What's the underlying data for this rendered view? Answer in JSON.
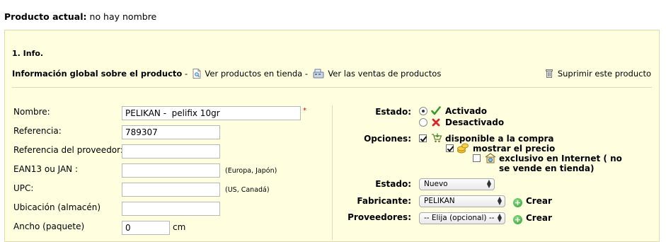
{
  "header": {
    "label": "Producto actual:",
    "value": "no hay nombre"
  },
  "section": {
    "title": "1. Info."
  },
  "global": {
    "label": "Información global sobre el producto",
    "dash": "-",
    "view_in_store": "Ver productos en tienda",
    "view_sales": "Ver las ventas de productos",
    "delete": "Suprimir este producto"
  },
  "fields": {
    "name": {
      "label": "Nombre:",
      "value": "PELIKAN -  pelifix 10gr",
      "required_mark": "*"
    },
    "reference": {
      "label": "Referencia:",
      "value": "789307"
    },
    "supplier_reference": {
      "label": "Referencia del proveedor:",
      "value": ""
    },
    "ean13": {
      "label": "EAN13 ou JAN :",
      "value": "",
      "hint": "(Europa, Japón)"
    },
    "upc": {
      "label": "UPC:",
      "value": "",
      "hint": "(US, Canadá)"
    },
    "location": {
      "label": "Ubicación (almacén)",
      "value": ""
    },
    "width": {
      "label": "Ancho (paquete)",
      "value": "0",
      "unit": "cm"
    }
  },
  "status": {
    "label": "Estado:",
    "activated": "Activado",
    "deactivated": "Desactivado",
    "selected": "Activado"
  },
  "options": {
    "label": "Opciones:",
    "available_for_order": "disponible a la compra",
    "show_price": "mostrar el precio",
    "online_only_1": "exclusivo en Internet ( no",
    "online_only_2": "se vende en tienda)",
    "available_for_order_checked": true,
    "show_price_checked": true,
    "online_only_checked": false
  },
  "condition": {
    "label": "Estado:",
    "value": "Nuevo"
  },
  "manufacturer": {
    "label": "Fabricante:",
    "value": "PELIKAN",
    "create": "Crear"
  },
  "suppliers": {
    "label": "Proveedores:",
    "value": "-- Elija (opcional) --",
    "create": "Crear"
  },
  "colors": {
    "panel_bg": "#ffffe0",
    "required": "#cc0000",
    "check_green": "#3a9a2a",
    "cross_red": "#d8262b"
  }
}
